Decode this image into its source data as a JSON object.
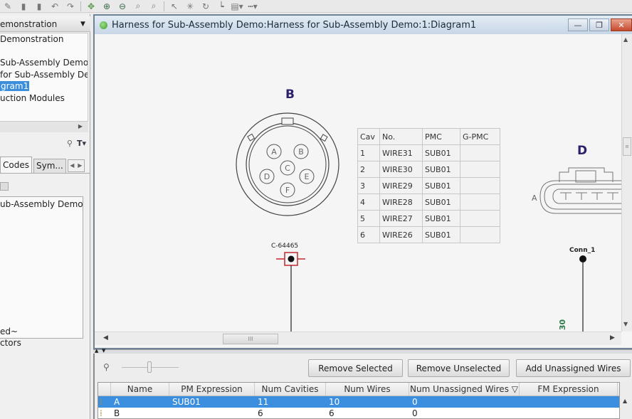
{
  "toolbar": {
    "icons": [
      "wire-tool-icon",
      "copy-icon",
      "paste-icon",
      "undo-icon",
      "redo-icon",
      "pan-icon",
      "zoom-in-icon",
      "zoom-out-icon",
      "zoom-area-icon",
      "zoom-fit-icon",
      "select-pointer-icon",
      "sparkle-icon",
      "rotate-icon",
      "step-icon",
      "align-icon",
      "line-style-icon"
    ]
  },
  "left_panel": {
    "project_dropdown": "emonstration",
    "tree_items": [
      {
        "label": "Demonstration",
        "selected": false
      },
      {
        "label": "",
        "selected": false
      },
      {
        "label": "Sub-Assembly Demo",
        "selected": false
      },
      {
        "label": "for Sub-Assembly De",
        "selected": false
      },
      {
        "label": "gram1",
        "selected": true
      },
      {
        "label": "uction Modules",
        "selected": false
      }
    ],
    "tabs": [
      {
        "label": "Codes",
        "active": true
      },
      {
        "label": "Sym...",
        "active": false
      }
    ],
    "list_items": [
      "ub-Assembly Demo"
    ],
    "bottom_lines": [
      "ed~",
      "ctors"
    ]
  },
  "window": {
    "title": "Harness for Sub-Assembly Demo:Harness for Sub-Assembly Demo:1:Diagram1",
    "buttons": {
      "minimize": "—",
      "restore": "❐",
      "close": "✕"
    }
  },
  "diagram": {
    "connector_b": {
      "label": "B",
      "cavities": [
        "A",
        "B",
        "C",
        "D",
        "E",
        "F"
      ],
      "part_number": "C-64465"
    },
    "pin_table": {
      "headers": [
        "Cav",
        "No.",
        "PMC",
        "G-PMC"
      ],
      "rows": [
        [
          "1",
          "WIRE31",
          "SUB01",
          ""
        ],
        [
          "2",
          "WIRE30",
          "SUB01",
          ""
        ],
        [
          "3",
          "WIRE29",
          "SUB01",
          ""
        ],
        [
          "4",
          "WIRE28",
          "SUB01",
          ""
        ],
        [
          "5",
          "WIRE27",
          "SUB01",
          ""
        ],
        [
          "6",
          "WIRE26",
          "SUB01",
          ""
        ]
      ]
    },
    "connector_d": {
      "label": "D",
      "side_label": "A",
      "name": "Conn_1",
      "wire_label": "30"
    },
    "scroll_thumb": "III"
  },
  "bottom_panel": {
    "buttons": {
      "remove_selected": "Remove Selected",
      "remove_unselected": "Remove Unselected",
      "add_unassigned": "Add Unassigned Wires"
    },
    "grid": {
      "headers": [
        "",
        "Name",
        "PM Expression",
        "Num Cavities",
        "Num Wires",
        "Num Unassigned Wires ▽",
        "FM Expression"
      ],
      "rows": [
        {
          "name": "A",
          "pm_expression": "SUB01",
          "num_cavities": "11",
          "num_wires": "10",
          "num_unassigned": "0",
          "fm_expression": "",
          "selected": true
        },
        {
          "name": "B",
          "pm_expression": "",
          "num_cavities": "6",
          "num_wires": "6",
          "num_unassigned": "0",
          "fm_expression": "",
          "selected": false
        }
      ]
    }
  },
  "colors": {
    "selection": "#3c8fde",
    "connector_label": "#2d1f6b",
    "pin_marker": "#c0282f",
    "wire_label": "#2f7a4a"
  }
}
